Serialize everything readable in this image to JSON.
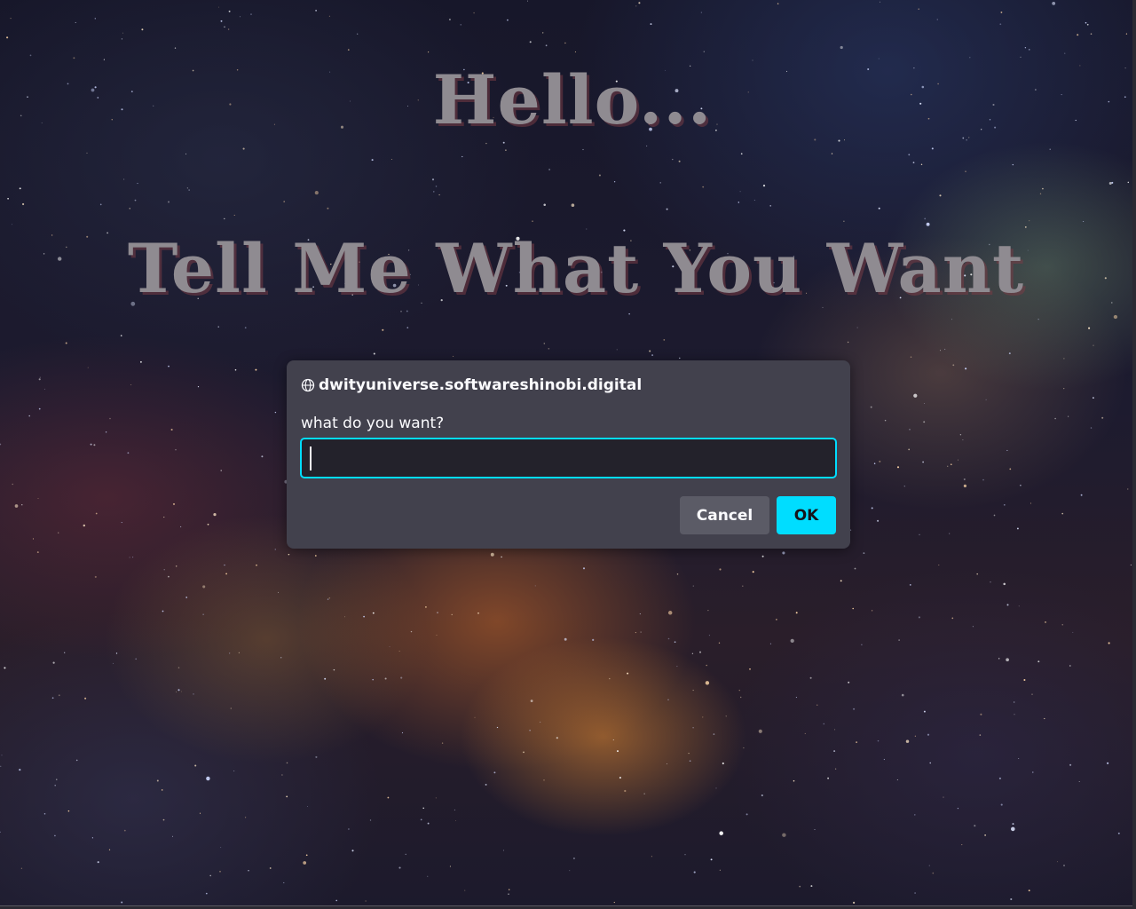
{
  "page": {
    "heading_line1": "Hello...",
    "heading_line2": "Tell Me What You Want",
    "background": "space-nebula"
  },
  "dialog": {
    "origin_icon": "globe-icon",
    "origin": "dwityuniverse.softwareshinobi.digital",
    "message": "what do you want?",
    "input_value": "",
    "cancel_label": "Cancel",
    "ok_label": "OK"
  },
  "colors": {
    "dialog_bg": "#42414d",
    "accent": "#00ddff",
    "heading_text": "#8f8b91",
    "input_bg": "#23222b"
  }
}
